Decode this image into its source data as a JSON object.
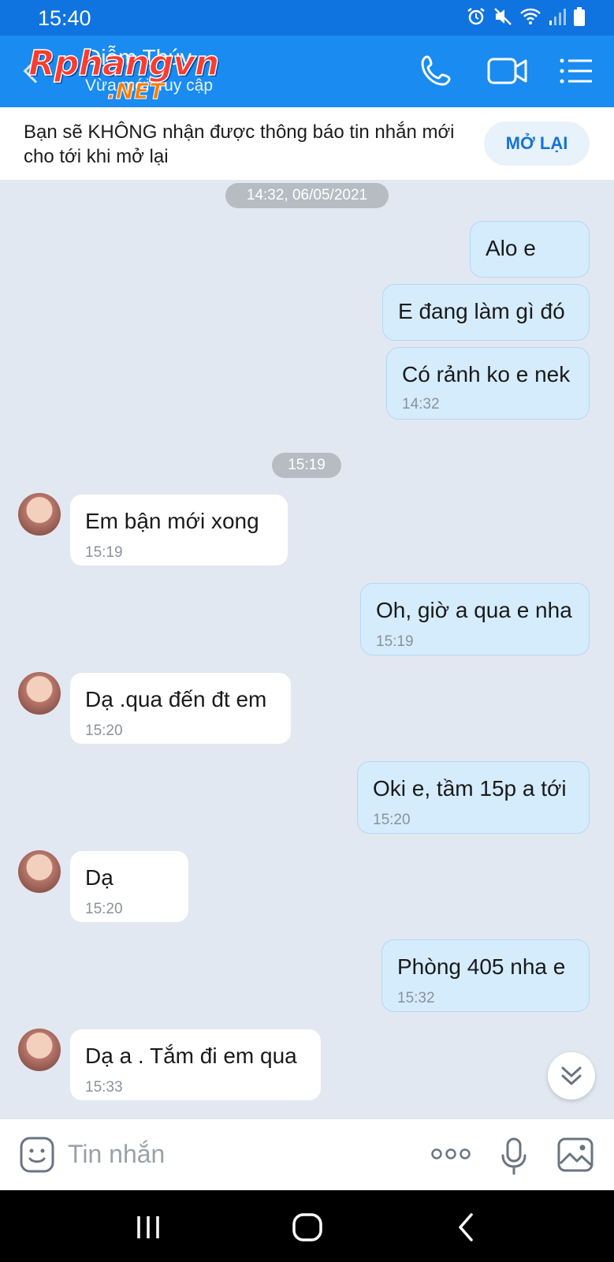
{
  "status_bar": {
    "time": "15:40"
  },
  "header": {
    "contact_name": "Diễm Thúy",
    "contact_status": "Vừa mới truy cập",
    "watermark": "Rphangvn",
    "watermark_suffix": ".NET"
  },
  "notice": {
    "text": "Bạn sẽ KHÔNG nhận được thông báo tin nhắn mới cho tới khi mở lại",
    "button_label": "MỞ LẠI"
  },
  "chat": {
    "date_pill_1": "14:32, 06/05/2021",
    "date_pill_2": "15:19",
    "messages": [
      {
        "dir": "out",
        "text": "Alo e",
        "time": ""
      },
      {
        "dir": "out",
        "text": "E đang làm gì đó",
        "time": ""
      },
      {
        "dir": "out",
        "text": "Có rảnh ko e nek",
        "time": "14:32"
      },
      {
        "dir": "in",
        "text": "Em bận mới xong",
        "time": "15:19"
      },
      {
        "dir": "out",
        "text": "Oh, giờ a qua e nha",
        "time": "15:19"
      },
      {
        "dir": "in",
        "text": "Dạ .qua đến đt em",
        "time": "15:20"
      },
      {
        "dir": "out",
        "text": "Oki e, tầm 15p a tới",
        "time": "15:20"
      },
      {
        "dir": "in",
        "text": "Dạ",
        "time": "15:20"
      },
      {
        "dir": "out",
        "text": "Phòng 405 nha e",
        "time": "15:32"
      },
      {
        "dir": "in",
        "text": "Dạ a . Tắm đi em qua",
        "time": "15:33"
      }
    ]
  },
  "input_bar": {
    "placeholder": "Tin nhắn"
  },
  "icons": {
    "back": "back-arrow-icon",
    "call": "phone-icon",
    "video": "video-camera-icon",
    "menu": "list-menu-icon",
    "scroll": "double-chevron-down-icon",
    "sticker": "sticker-smile-icon",
    "more": "more-dots-icon",
    "mic": "microphone-icon",
    "gallery": "image-gallery-icon"
  },
  "colors": {
    "header": "#1a8bf0",
    "statusbar": "#0f73e0",
    "outgoing_bubble": "#d5ecfd",
    "incoming_bubble": "#ffffff",
    "chat_bg": "#e2e8f1",
    "accent": "#1473d8"
  }
}
